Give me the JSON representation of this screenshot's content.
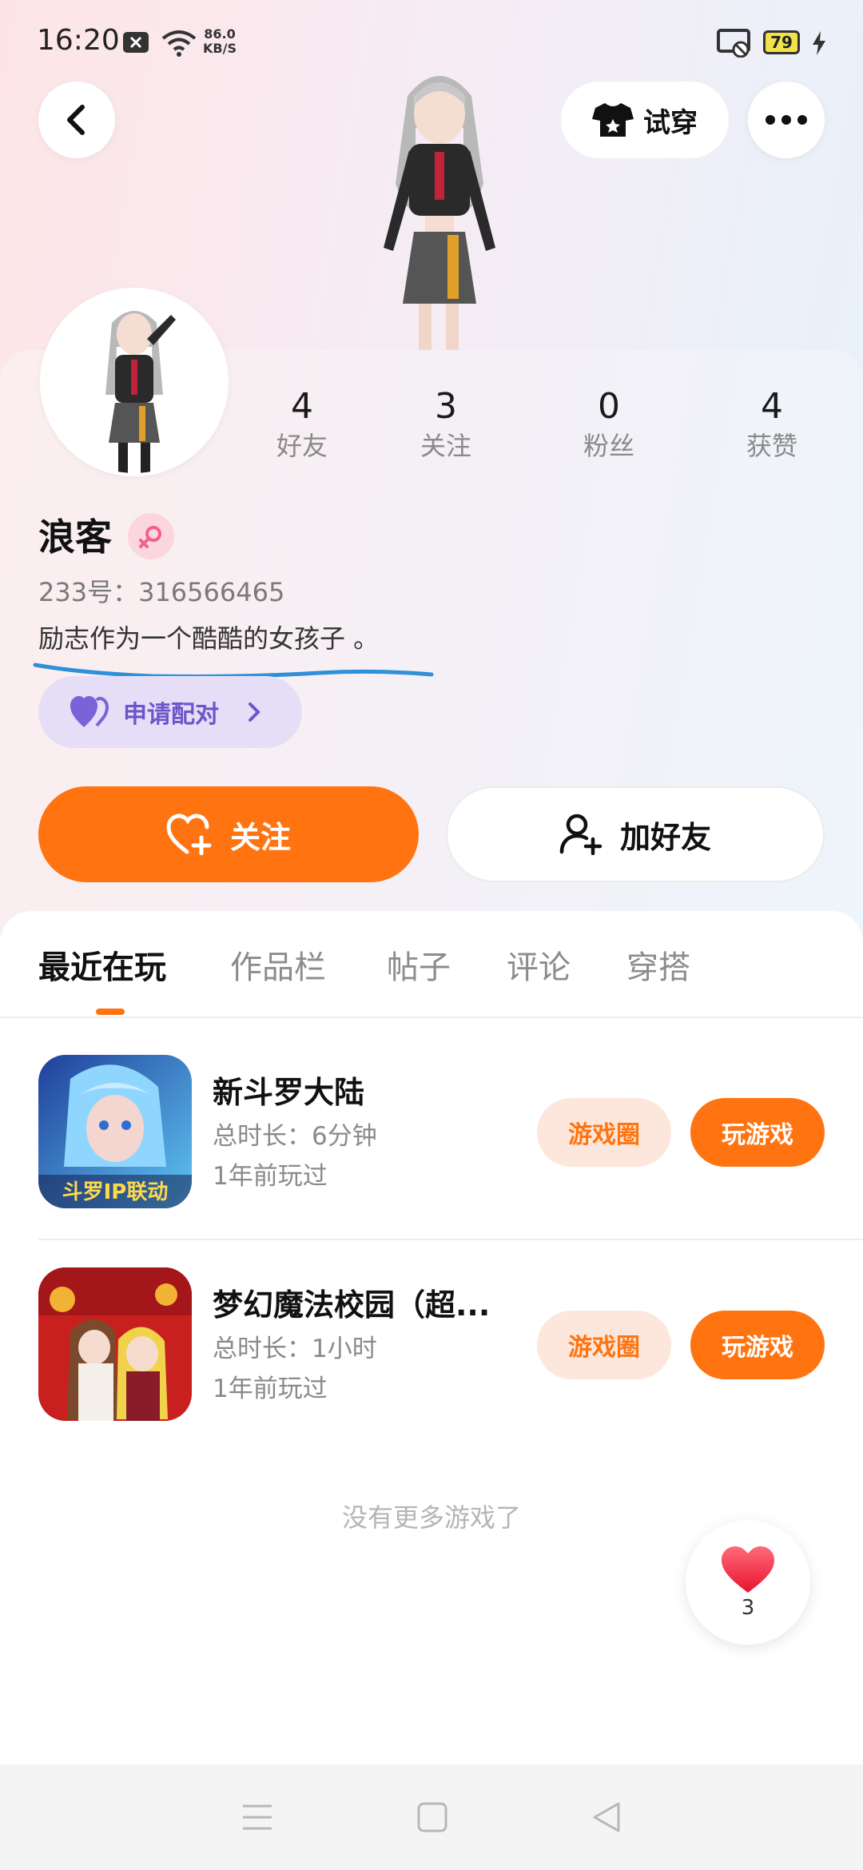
{
  "status_bar": {
    "time": "16:20",
    "speed_value": "86.0",
    "speed_unit": "KB/S",
    "battery": "79"
  },
  "header": {
    "try_on_label": "试穿"
  },
  "profile": {
    "stats": [
      {
        "value": "4",
        "label": "好友"
      },
      {
        "value": "3",
        "label": "关注"
      },
      {
        "value": "0",
        "label": "粉丝"
      },
      {
        "value": "4",
        "label": "获赞"
      }
    ],
    "name": "浪客",
    "uid": "233号：316566465",
    "bio": "励志作为一个酷酷的女孩子 。",
    "pair_label": "申请配对"
  },
  "actions": {
    "follow_label": "关注",
    "add_friend_label": "加好友"
  },
  "tabs": [
    {
      "label": "最近在玩"
    },
    {
      "label": "作品栏"
    },
    {
      "label": "帖子"
    },
    {
      "label": "评论"
    },
    {
      "label": "穿搭"
    }
  ],
  "games": [
    {
      "title": "新斗罗大陆",
      "duration": "总时长：6分钟",
      "last_played": "1年前玩过",
      "icon_text": "斗罗IP联动",
      "circle_label": "游戏圈",
      "play_label": "玩游戏"
    },
    {
      "title": "梦幻魔法校园（超...",
      "duration": "总时长：1小时",
      "last_played": "1年前玩过",
      "circle_label": "游戏圈",
      "play_label": "玩游戏"
    }
  ],
  "no_more": "没有更多游戏了",
  "like_fab": {
    "count": "3"
  },
  "colors": {
    "accent": "#ff7411",
    "pair": "#6b56c9",
    "gender_bg": "#fbd6df",
    "underline": "#2f8fd8"
  }
}
